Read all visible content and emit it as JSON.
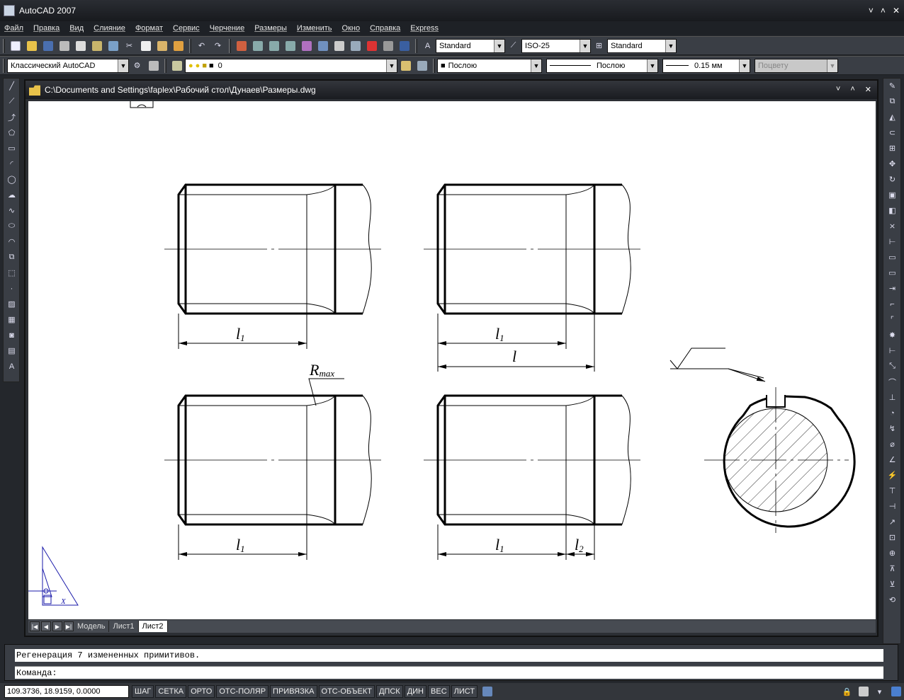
{
  "window": {
    "title": "AutoCAD 2007",
    "controls": [
      "˅",
      "˄",
      "✕"
    ]
  },
  "menu": [
    "Файл",
    "Правка",
    "Вид",
    "Слияние",
    "Формат",
    "Сервис",
    "Черчение",
    "Размеры",
    "Изменить",
    "Окно",
    "Справка",
    "Express"
  ],
  "toolbar": {
    "text_style": "Standard",
    "dim_style": "ISO-25",
    "table_style": "Standard",
    "workspace": "Классический AutoCAD",
    "layer": "0",
    "color": "Послою",
    "linetype": "Послою",
    "lineweight": "0.15 мм",
    "plotstyle": "Поцвету"
  },
  "document": {
    "title": "C:\\Documents and Settings\\faplex\\Рабочий стол\\Дунаев\\Размеры.dwg",
    "tabs": [
      "Модель",
      "Лист1",
      "Лист2"
    ],
    "active_tab": "Лист2"
  },
  "drawing": {
    "dim_l1": "l",
    "dim_l1_sub": "1",
    "dim_l": "l",
    "dim_l2": "l",
    "dim_l2_sub": "2",
    "radius_label": "R",
    "radius_sub": "max"
  },
  "command": {
    "history": "Регенерация 7 измененных примитивов.",
    "prompt": "Команда:"
  },
  "status": {
    "coords": "109.3736, 18.9159, 0.0000",
    "buttons": [
      "ШАГ",
      "СЕТКА",
      "ОРТО",
      "ОТС-ПОЛЯР",
      "ПРИВЯЗКА",
      "ОТС-ОБЪЕКТ",
      "ДПСК",
      "ДИН",
      "ВЕС",
      "ЛИСТ"
    ]
  }
}
